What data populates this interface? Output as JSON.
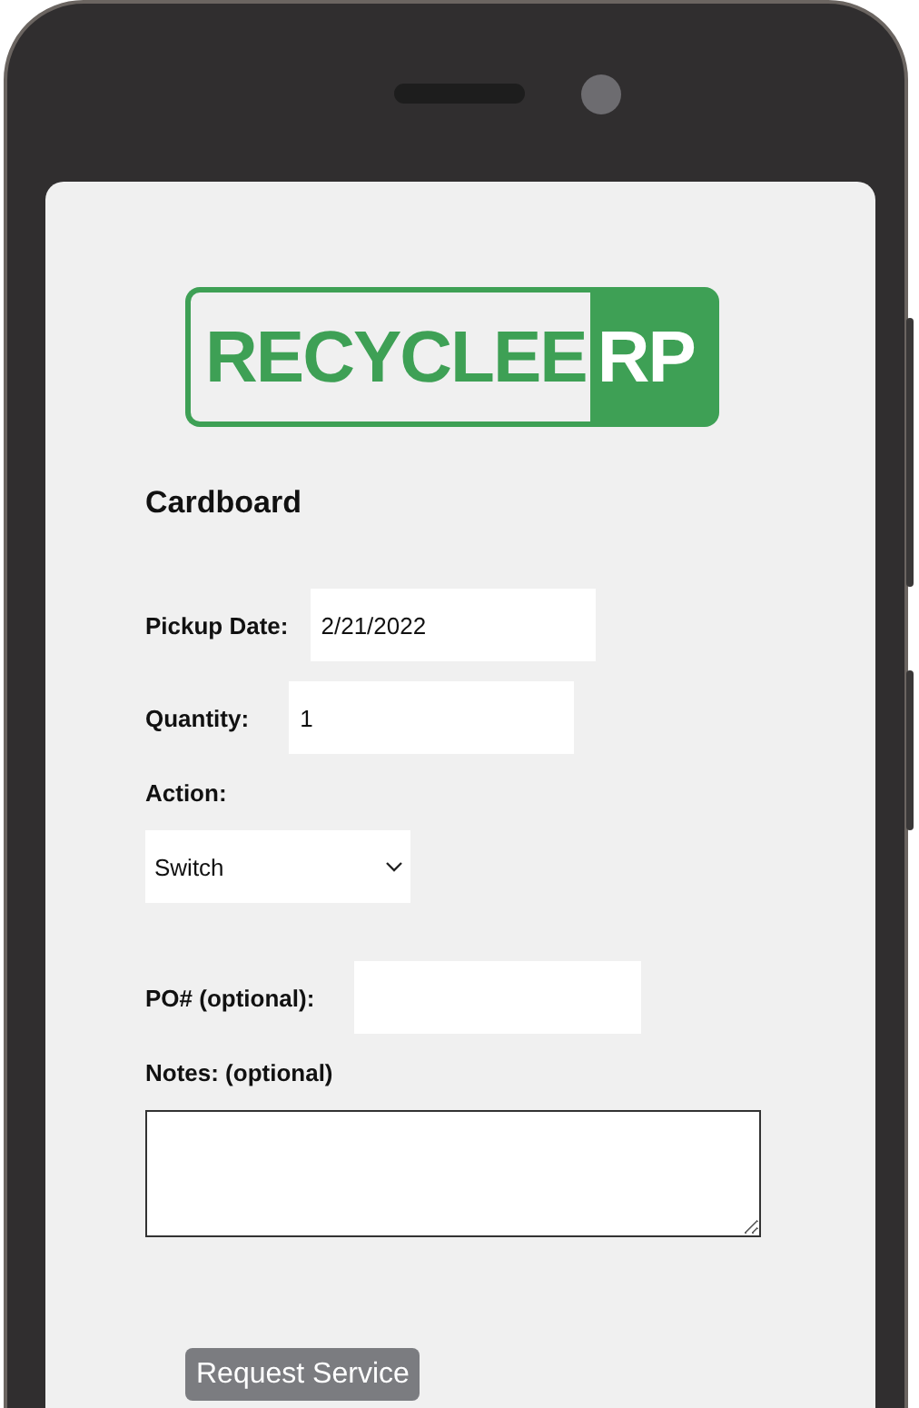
{
  "logo": {
    "outline_text": "RECYCLE",
    "overlap_text": "E",
    "filled_text": "RP"
  },
  "heading": "Cardboard",
  "pickup_date": {
    "label": "Pickup Date:",
    "value": "2/21/2022"
  },
  "quantity": {
    "label": "Quantity:",
    "value": "1"
  },
  "action": {
    "label": "Action:",
    "value": "Switch"
  },
  "po_number": {
    "label": "PO# (optional):"
  },
  "notes": {
    "label": "Notes: (optional)"
  },
  "submit_button": {
    "label": "Request Service",
    "disabled": true
  }
}
